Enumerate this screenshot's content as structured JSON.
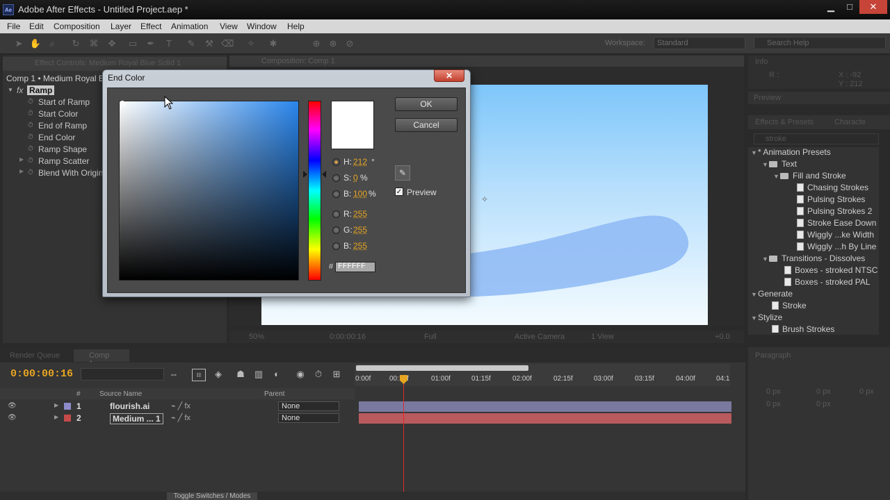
{
  "window": {
    "title": "Adobe After Effects - Untitled Project.aep *",
    "app_icon": "Ae"
  },
  "menu": [
    "File",
    "Edit",
    "Composition",
    "Layer",
    "Effect",
    "Animation",
    "View",
    "Window",
    "Help"
  ],
  "toolbar": {
    "workspace_label": "Workspace:",
    "workspace_value": "Standard",
    "search_placeholder": "Search Help"
  },
  "effect_controls": {
    "tab": "Effect Controls: Medium Royal Blue Solid 1",
    "breadcrumb": "Comp 1 • Medium Royal Bl",
    "effect_name": "Ramp",
    "properties": [
      "Start of Ramp",
      "Start Color",
      "End of Ramp",
      "End Color",
      "Ramp Shape",
      "Ramp Scatter",
      "Blend With Origin"
    ]
  },
  "composition": {
    "tab": "Composition: Comp 1",
    "footer": {
      "zoom": "50%",
      "timecode": "0:00:00:16",
      "resolution": "Full",
      "camera": "Active Camera",
      "views": "1 View",
      "exposure": "+0.0"
    }
  },
  "info": {
    "title": "Info",
    "r": "R :",
    "x": "X : -92",
    "y": "Y : 212"
  },
  "preview": {
    "title": "Preview"
  },
  "effects_presets": {
    "tab": "Effects & Presets",
    "tab2": "Characte",
    "search_value": "stroke",
    "items": [
      {
        "label": "* Animation Presets",
        "kind": "category"
      },
      {
        "label": "Text",
        "kind": "folder"
      },
      {
        "label": "Fill and Stroke",
        "kind": "folder"
      },
      {
        "label": "Chasing Strokes",
        "kind": "preset"
      },
      {
        "label": "Pulsing Strokes",
        "kind": "preset"
      },
      {
        "label": "Pulsing Strokes 2",
        "kind": "preset"
      },
      {
        "label": "Stroke Ease Down",
        "kind": "preset"
      },
      {
        "label": "Wiggly ...ke Width",
        "kind": "preset"
      },
      {
        "label": "Wiggly ...h By Line",
        "kind": "preset"
      },
      {
        "label": "Transitions - Dissolves",
        "kind": "folder"
      },
      {
        "label": "Boxes - stroked NTSC",
        "kind": "preset"
      },
      {
        "label": "Boxes - stroked PAL",
        "kind": "preset"
      },
      {
        "label": "Generate",
        "kind": "category"
      },
      {
        "label": "Stroke",
        "kind": "effect"
      },
      {
        "label": "Stylize",
        "kind": "category"
      },
      {
        "label": "Brush Strokes",
        "kind": "effect"
      }
    ]
  },
  "paragraph": {
    "title": "Paragraph",
    "values": [
      "0 px",
      "0 px",
      "0 px",
      "0 px",
      "0 px"
    ]
  },
  "timeline": {
    "render_queue_tab": "Render Queue",
    "comp_tab": "Comp 1",
    "timecode": "0:00:00:16",
    "header": {
      "hash": "#",
      "source_name": "Source Name",
      "parent": "Parent"
    },
    "layers": [
      {
        "num": "1",
        "name": "flourish.ai",
        "parent": "None",
        "color": "#8d8bc9"
      },
      {
        "num": "2",
        "name": "Medium ... 1",
        "parent": "None",
        "color": "#c64a4a"
      }
    ],
    "ruler": [
      "0:00f",
      "00:15f",
      "01:00f",
      "01:15f",
      "02:00f",
      "02:15f",
      "03:00f",
      "03:15f",
      "04:00f",
      "04:1"
    ],
    "toggle_label": "Toggle Switches / Modes"
  },
  "dialog": {
    "title": "End Color",
    "ok": "OK",
    "cancel": "Cancel",
    "preview_label": "Preview",
    "preview_checked": true,
    "fields": [
      {
        "label": "H:",
        "value": "212",
        "unit": "°",
        "selected": true
      },
      {
        "label": "S:",
        "value": "0",
        "unit": "%",
        "selected": false
      },
      {
        "label": "B:",
        "value": "100",
        "unit": "%",
        "selected": false
      },
      {
        "label": "R:",
        "value": "255",
        "unit": "",
        "selected": false
      },
      {
        "label": "G:",
        "value": "255",
        "unit": "",
        "selected": false
      },
      {
        "label": "B:",
        "value": "255",
        "unit": "",
        "selected": false
      }
    ],
    "hex_label": "#",
    "hex": "FFFFFF",
    "swatch_color": "#ffffff",
    "field_hue_color": "#2a86ec"
  },
  "colors": {
    "timecode": "#e7a521",
    "close_button": "#c74438",
    "accent_value": "#e7a521"
  }
}
